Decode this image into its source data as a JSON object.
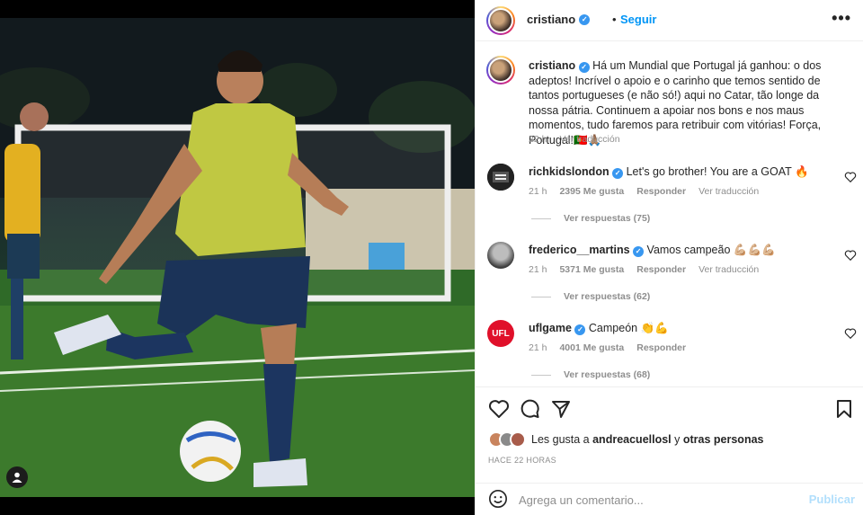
{
  "header": {
    "username": "cristiano",
    "separator": "•",
    "follow_label": "Seguir",
    "more_label": "•••"
  },
  "caption": {
    "username": "cristiano",
    "text": "Há um Mundial que Portugal já ganhou: o dos adeptos! Incrível o apoio e o carinho que temos sentido de tantos portugueses (e não só!) aqui no Catar, tão longe da nossa pátria. Continuem a apoiar nos bons e nos maus momentos, tudo faremos para retribuir com vitórias! Força, Portugal!🇵🇹🙏🏽",
    "time": "22 h",
    "translate": "Ver traducción"
  },
  "comments": [
    {
      "username": "richkidslondon",
      "text": "Let's go brother! You are a GOAT 🔥",
      "time": "21 h",
      "likes": "2395 Me gusta",
      "reply": "Responder",
      "translate": "Ver traducción",
      "replies": "Ver respuestas (75)",
      "avatar_label": "RICH KIDS"
    },
    {
      "username": "frederico__martins",
      "text": "Vamos campeão 💪🏼💪🏼💪🏼",
      "time": "21 h",
      "likes": "5371 Me gusta",
      "reply": "Responder",
      "translate": "Ver traducción",
      "replies": "Ver respuestas (62)"
    },
    {
      "username": "uflgame",
      "text": "Campeón 👏💪",
      "time": "21 h",
      "likes": "4001 Me gusta",
      "reply": "Responder",
      "replies": "Ver respuestas (68)",
      "avatar_label": "UFL"
    }
  ],
  "likes": {
    "prefix": "Les gusta a ",
    "user": "andreacuellosl",
    "middle": " y ",
    "others": "otras personas"
  },
  "timestamp": "HACE 22 HORAS",
  "add_comment": {
    "placeholder": "Agrega un comentario...",
    "post_label": "Publicar"
  },
  "colors": {
    "accent": "#0095f6",
    "verified": "#3897f0",
    "secondary_text": "#8e8e8e",
    "post_disabled": "#b2dffc"
  }
}
